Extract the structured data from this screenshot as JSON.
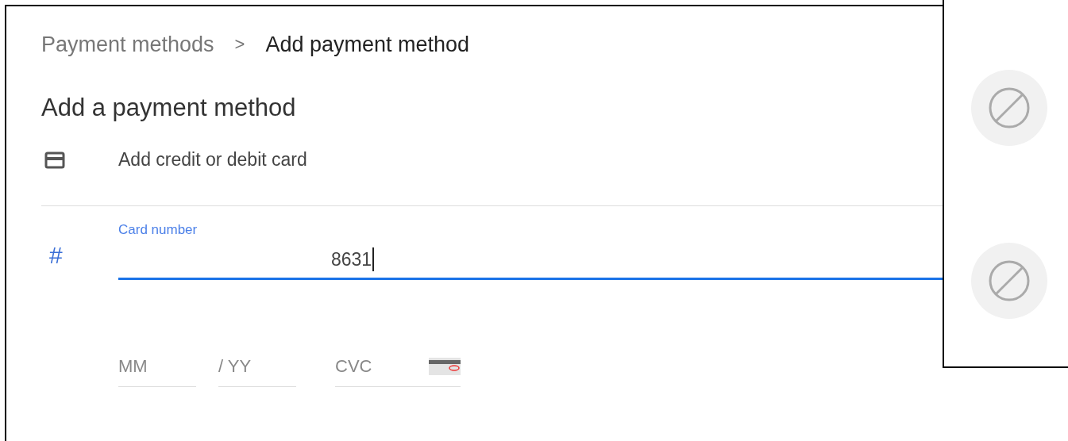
{
  "breadcrumb": [
    {
      "label": "Payment methods",
      "current": false
    },
    {
      "label": "Add payment method",
      "current": true
    }
  ],
  "breadcrumb_separator": ">",
  "heading": "Add a payment method",
  "option": {
    "label": "Add credit or debit card"
  },
  "card_number": {
    "icon": "#",
    "label": "Card number",
    "value": "8631",
    "focused": true
  },
  "expiry_month": {
    "placeholder": "MM"
  },
  "expiry_year": {
    "placeholder": "/ YY"
  },
  "cvc": {
    "placeholder": "CVC"
  },
  "side_panel": {
    "items": [
      {
        "kind": "blocked"
      },
      {
        "kind": "blocked"
      }
    ]
  }
}
